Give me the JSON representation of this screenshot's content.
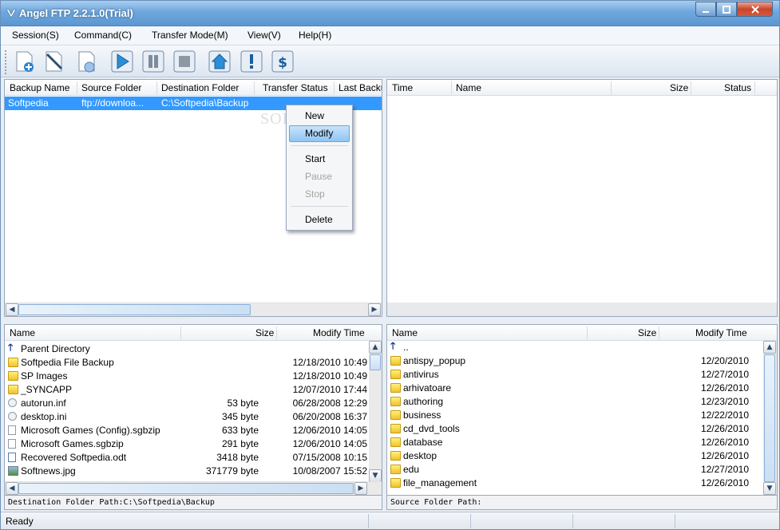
{
  "window": {
    "title": "Angel FTP 2.2.1.0(Trial)"
  },
  "menu": [
    "Session(S)",
    "Command(C)",
    "Transfer Mode(M)",
    "View(V)",
    "Help(H)"
  ],
  "toolbar_icons": [
    "new-backup-icon",
    "edit-icon",
    "browse-disk-icon",
    "start-icon",
    "pause-icon",
    "stop-icon",
    "home-icon",
    "info-icon",
    "purchase-icon"
  ],
  "backup_list": {
    "columns": [
      "Backup Name",
      "Source Folder",
      "Destination Folder",
      "Transfer Status",
      "Last Backu"
    ],
    "rows": [
      {
        "name": "Softpedia",
        "source": "ftp://downloa...",
        "dest": "C:\\Softpedia\\Backup",
        "status": "",
        "last": ""
      }
    ]
  },
  "transfer_log": {
    "columns": [
      "Time",
      "Name",
      "Size",
      "Status"
    ]
  },
  "context_menu": {
    "items": [
      {
        "label": "New",
        "enabled": true
      },
      {
        "label": "Modify",
        "enabled": true,
        "highlighted": true
      },
      {
        "label": "Start",
        "enabled": true
      },
      {
        "label": "Pause",
        "enabled": false
      },
      {
        "label": "Stop",
        "enabled": false
      },
      {
        "label": "Delete",
        "enabled": true
      }
    ]
  },
  "local_files": {
    "columns": [
      "Name",
      "Size",
      "Modify Time"
    ],
    "rows": [
      {
        "icon": "up-arrow-icon",
        "name": "Parent Directory",
        "size": "",
        "time": ""
      },
      {
        "icon": "folder-icon",
        "name": "Softpedia File Backup",
        "size": "",
        "time": "12/18/2010 10:49"
      },
      {
        "icon": "folder-icon",
        "name": "SP Images",
        "size": "",
        "time": "12/18/2010 10:49"
      },
      {
        "icon": "folder-icon",
        "name": "_SYNCAPP",
        "size": "",
        "time": "12/07/2010 17:44"
      },
      {
        "icon": "settings-file-icon",
        "name": "autorun.inf",
        "size": "53 byte",
        "time": "06/28/2008 12:29"
      },
      {
        "icon": "settings-file-icon",
        "name": "desktop.ini",
        "size": "345 byte",
        "time": "06/20/2008 16:37"
      },
      {
        "icon": "file-icon",
        "name": "Microsoft Games (Config).sgbzip",
        "size": "633 byte",
        "time": "12/06/2010 14:05"
      },
      {
        "icon": "file-icon",
        "name": "Microsoft Games.sgbzip",
        "size": "291 byte",
        "time": "12/06/2010 14:05"
      },
      {
        "icon": "document-icon",
        "name": "Recovered Softpedia.odt",
        "size": "3418 byte",
        "time": "07/15/2008 10:15"
      },
      {
        "icon": "image-file-icon",
        "name": "Softnews.jpg",
        "size": "371779 byte",
        "time": "10/08/2007 15:52"
      }
    ],
    "path_label": "Destination Folder Path:",
    "path_value": "C:\\Softpedia\\Backup"
  },
  "remote_files": {
    "columns": [
      "Name",
      "Size",
      "Modify Time"
    ],
    "rows": [
      {
        "icon": "up-arrow-icon",
        "name": "..",
        "time": ""
      },
      {
        "icon": "folder-icon",
        "name": "antispy_popup",
        "time": "12/20/2010"
      },
      {
        "icon": "folder-icon",
        "name": "antivirus",
        "time": "12/27/2010"
      },
      {
        "icon": "folder-icon",
        "name": "arhivatoare",
        "time": "12/26/2010"
      },
      {
        "icon": "folder-icon",
        "name": "authoring",
        "time": "12/23/2010"
      },
      {
        "icon": "folder-icon",
        "name": "business",
        "time": "12/22/2010"
      },
      {
        "icon": "folder-icon",
        "name": "cd_dvd_tools",
        "time": "12/26/2010"
      },
      {
        "icon": "folder-icon",
        "name": "database",
        "time": "12/26/2010"
      },
      {
        "icon": "folder-icon",
        "name": "desktop",
        "time": "12/26/2010"
      },
      {
        "icon": "folder-icon",
        "name": "edu",
        "time": "12/27/2010"
      },
      {
        "icon": "folder-icon",
        "name": "file_management",
        "time": "12/26/2010"
      }
    ],
    "path_label": "Source Folder Path:"
  },
  "status": {
    "text": "Ready"
  },
  "watermark": "SOFTPEDIA",
  "colors": {
    "selection": "#3399ff",
    "titlebar": "#6ea7dc"
  }
}
